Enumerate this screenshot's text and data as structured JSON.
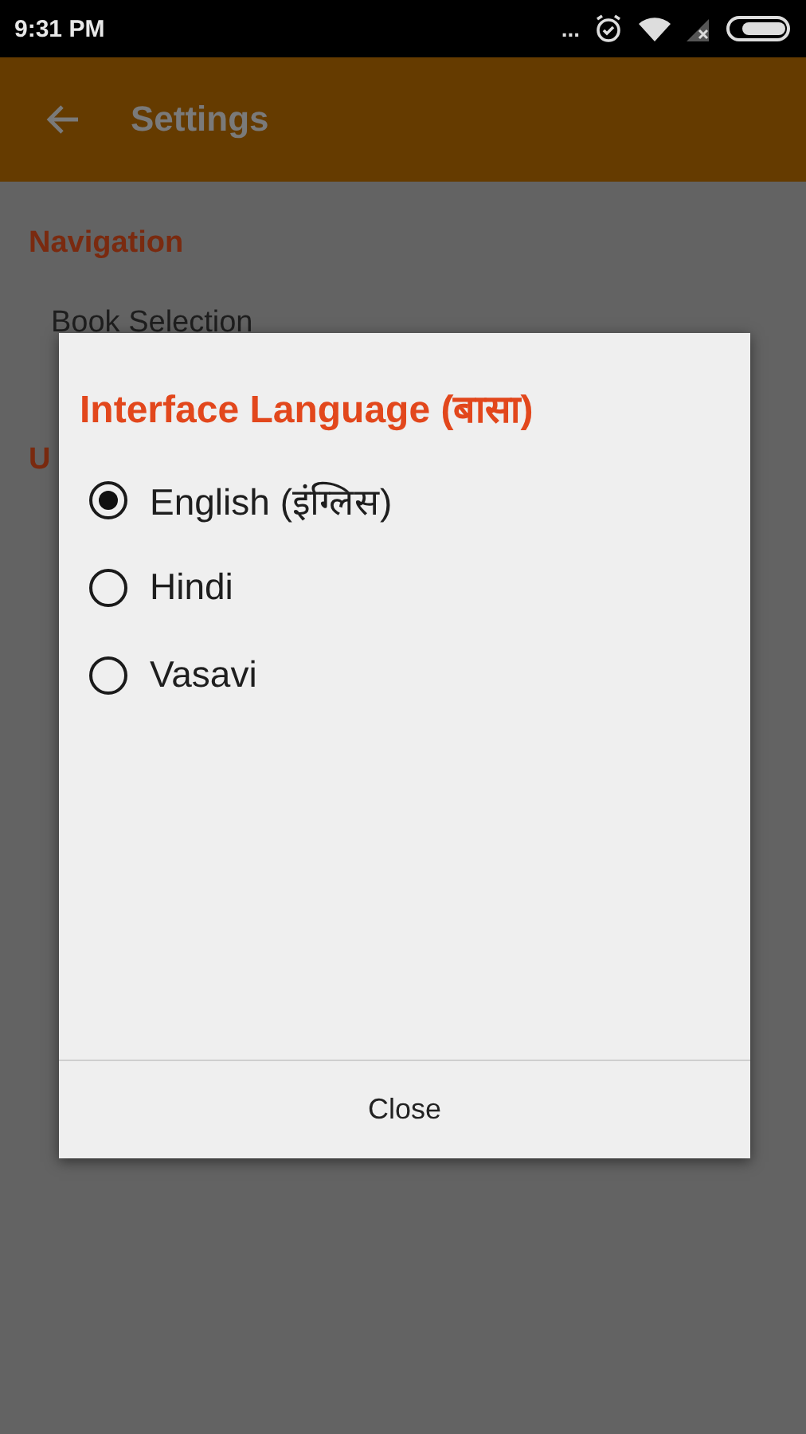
{
  "status_bar": {
    "time": "9:31 PM",
    "notification_dots": "..."
  },
  "app_bar": {
    "title": "Settings"
  },
  "settings": [
    {
      "kind": "header",
      "text": "Navigation"
    },
    {
      "kind": "item",
      "text": "Book Selection"
    },
    {
      "kind": "header",
      "text": "U"
    }
  ],
  "dialog": {
    "title": "Interface Language (बासा)",
    "options": [
      {
        "label": "English (इंग्लिस)",
        "selected": true
      },
      {
        "label": "Hindi",
        "selected": false
      },
      {
        "label": "Vasavi",
        "selected": false
      }
    ],
    "buttons": [
      "Close"
    ]
  }
}
